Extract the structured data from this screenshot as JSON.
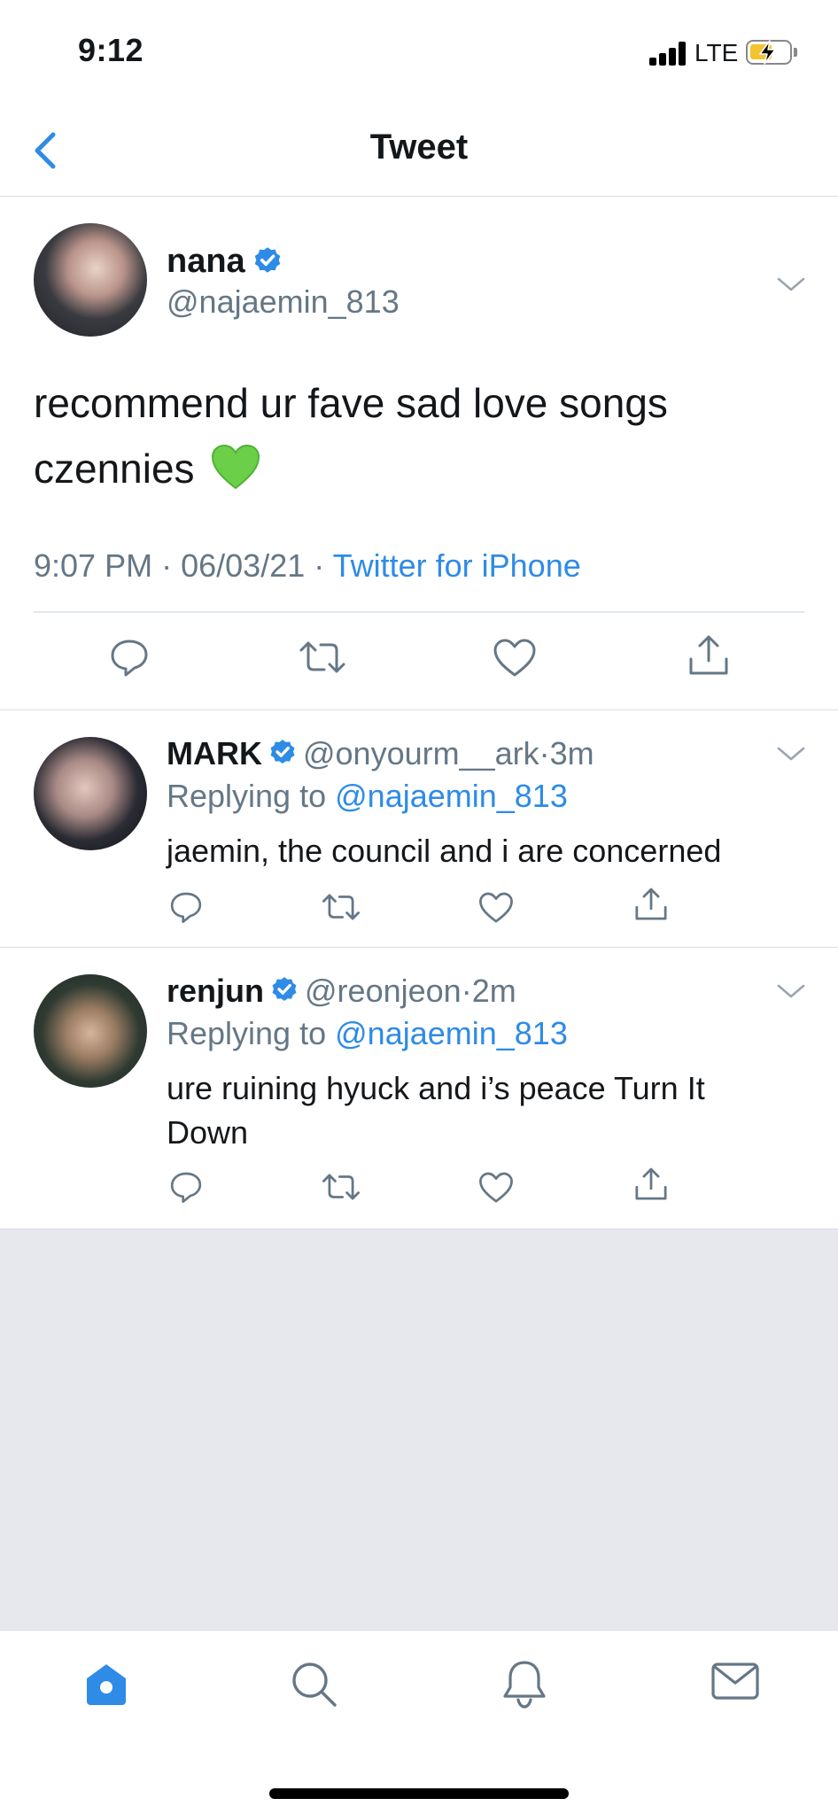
{
  "status_bar": {
    "time": "9:12",
    "network": "LTE",
    "battery_level": 0.55,
    "battery_color": "#f4c430",
    "charging": true
  },
  "header": {
    "title": "Tweet",
    "back_icon": "chevron-left-icon"
  },
  "colors": {
    "accent": "#2e8be6",
    "text": "#14171a",
    "secondary_text": "#657786",
    "divider": "#d9dde1",
    "empty_background": "#e6e8ed"
  },
  "main_tweet": {
    "display_name": "nana",
    "verified": true,
    "handle": "@najaemin_813",
    "text": "recommend ur fave sad love songs czennies",
    "emoji": "💚",
    "time": "9:07 PM",
    "date": "06/03/21",
    "separator": "·",
    "source": "Twitter for iPhone",
    "actions": [
      "reply-icon",
      "retweet-icon",
      "like-icon",
      "share-icon"
    ]
  },
  "replies": [
    {
      "display_name": "MARK",
      "verified": true,
      "handle": "@onyourm__ark",
      "age": "3m",
      "separator": "·",
      "replying_prefix": "Replying to",
      "replying_to": "@najaemin_813",
      "text": "jaemin, the council and i are concerned"
    },
    {
      "display_name": "renjun",
      "verified": true,
      "handle": "@reonjeon",
      "age": "2m",
      "separator": "·",
      "replying_prefix": "Replying to",
      "replying_to": "@najaemin_813",
      "text": "ure ruining hyuck and i’s peace Turn It Down"
    }
  ],
  "tab_bar": {
    "tabs": [
      "home-icon",
      "search-icon",
      "notifications-icon",
      "messages-icon"
    ],
    "active": "home-icon"
  }
}
